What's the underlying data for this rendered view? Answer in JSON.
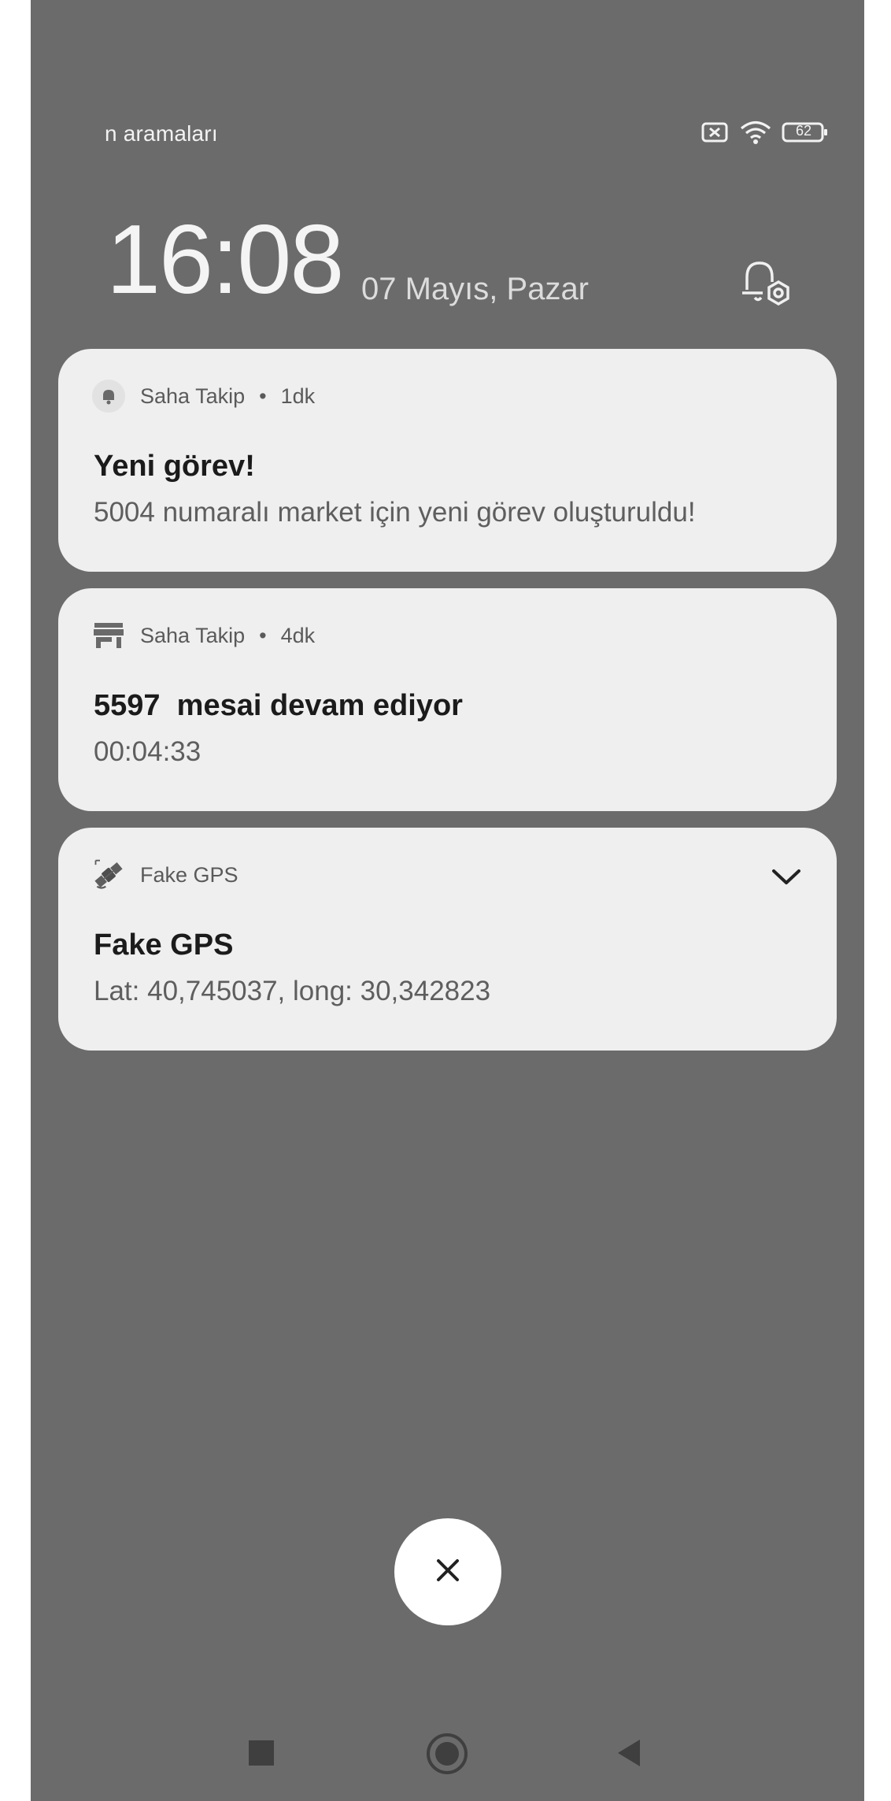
{
  "status_bar": {
    "carrier_text": "n aramaları",
    "battery_level": "62",
    "icons": [
      "sim-none-icon",
      "wifi-icon",
      "battery-icon"
    ]
  },
  "lockscreen": {
    "time": "16:08",
    "date": "07 Mayıs, Pazar",
    "settings_icon": "lock-settings-icon"
  },
  "notifications": [
    {
      "app": "Saha Takip",
      "age": "1dk",
      "icon": "bell-icon",
      "title": "Yeni görev!",
      "body": "5004 numaralı market için yeni görev oluşturuldu!"
    },
    {
      "app": "Saha Takip",
      "age": "4dk",
      "icon": "store-icon",
      "title": "5597  mesai devam ediyor",
      "body": "00:04:33"
    },
    {
      "app": "Fake GPS",
      "age": "",
      "icon": "satellite-icon",
      "title": "Fake GPS",
      "body": "Lat: 40,745037, long: 30,342823",
      "expandable": true
    }
  ],
  "dismiss_all": {
    "icon": "close-icon"
  },
  "navigation": {
    "buttons": [
      "recents-button",
      "home-button",
      "back-button"
    ]
  },
  "colors": {
    "background": "#6b6b6b",
    "card": "#efefef"
  }
}
